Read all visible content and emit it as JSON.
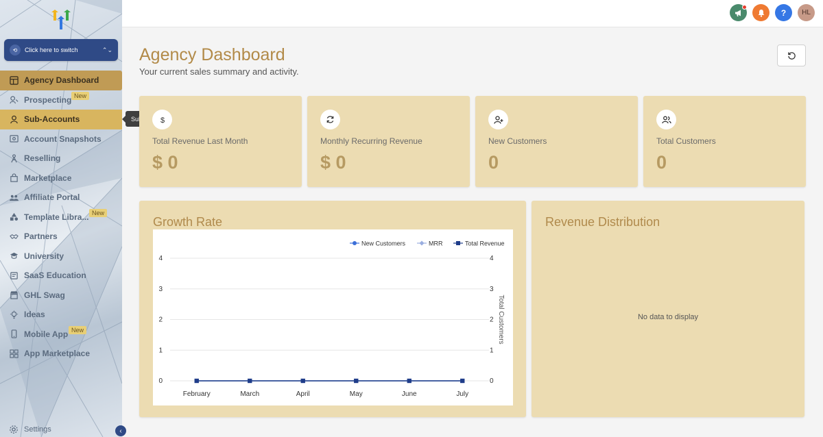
{
  "sidebar": {
    "switcher_label": "Click here to switch",
    "items": [
      {
        "label": "Agency Dashboard",
        "icon": "dashboard-icon",
        "badge": ""
      },
      {
        "label": "Prospecting",
        "icon": "prospecting-icon",
        "badge": "New"
      },
      {
        "label": "Sub-Accounts",
        "icon": "user-icon",
        "badge": ""
      },
      {
        "label": "Account Snapshots",
        "icon": "snapshot-icon",
        "badge": ""
      },
      {
        "label": "Reselling",
        "icon": "reselling-icon",
        "badge": ""
      },
      {
        "label": "Marketplace",
        "icon": "shopping-bag-icon",
        "badge": ""
      },
      {
        "label": "Affiliate Portal",
        "icon": "users-icon",
        "badge": ""
      },
      {
        "label": "Template Libra...",
        "icon": "shapes-icon",
        "badge": "New"
      },
      {
        "label": "Partners",
        "icon": "handshake-icon",
        "badge": ""
      },
      {
        "label": "University",
        "icon": "graduation-icon",
        "badge": ""
      },
      {
        "label": "SaaS Education",
        "icon": "education-icon",
        "badge": ""
      },
      {
        "label": "GHL Swag",
        "icon": "store-icon",
        "badge": ""
      },
      {
        "label": "Ideas",
        "icon": "lightbulb-icon",
        "badge": ""
      },
      {
        "label": "Mobile App",
        "icon": "mobile-icon",
        "badge": "New"
      },
      {
        "label": "App Marketplace",
        "icon": "grid-icon",
        "badge": ""
      }
    ],
    "tooltip": "Sub-Accounts",
    "settings_label": "Settings"
  },
  "topbar": {
    "avatar_initials": "HL",
    "help_label": "?"
  },
  "header": {
    "title": "Agency Dashboard",
    "subtitle": "Your current sales summary and activity."
  },
  "cards": [
    {
      "label": "Total Revenue Last Month",
      "value": "$ 0",
      "icon": "dollar-icon"
    },
    {
      "label": "Monthly Recurring Revenue",
      "value": "$ 0",
      "icon": "recurring-icon"
    },
    {
      "label": "New Customers",
      "value": "0",
      "icon": "user-plus-icon"
    },
    {
      "label": "Total Customers",
      "value": "0",
      "icon": "users-icon"
    }
  ],
  "growth": {
    "title": "Growth Rate"
  },
  "distribution": {
    "title": "Revenue Distribution",
    "empty_text": "No data to display"
  },
  "colors": {
    "accent": "#b08a4c",
    "card_bg": "#ecdcb2",
    "sidebar_active": "#c09b55",
    "switcher": "#2f4a86",
    "new_customers": "#3c6fd8",
    "mrr": "#9aaee0",
    "total_revenue": "#1f3d8a"
  },
  "chart_data": {
    "type": "line",
    "categories": [
      "February",
      "March",
      "April",
      "May",
      "June",
      "July"
    ],
    "series": [
      {
        "name": "New Customers",
        "values": [
          0,
          0,
          0,
          0,
          0,
          0
        ]
      },
      {
        "name": "MRR",
        "values": [
          0,
          0,
          0,
          0,
          0,
          0
        ]
      },
      {
        "name": "Total Revenue",
        "values": [
          0,
          0,
          0,
          0,
          0,
          0
        ]
      }
    ],
    "ylim": [
      0,
      4
    ],
    "y_ticks": [
      "0",
      "1",
      "2",
      "3",
      "4"
    ],
    "y2_label": "Total Customers",
    "y2_ticks": [
      "0",
      "1",
      "2",
      "3",
      "4"
    ],
    "legend": "top-right",
    "grid": true
  }
}
